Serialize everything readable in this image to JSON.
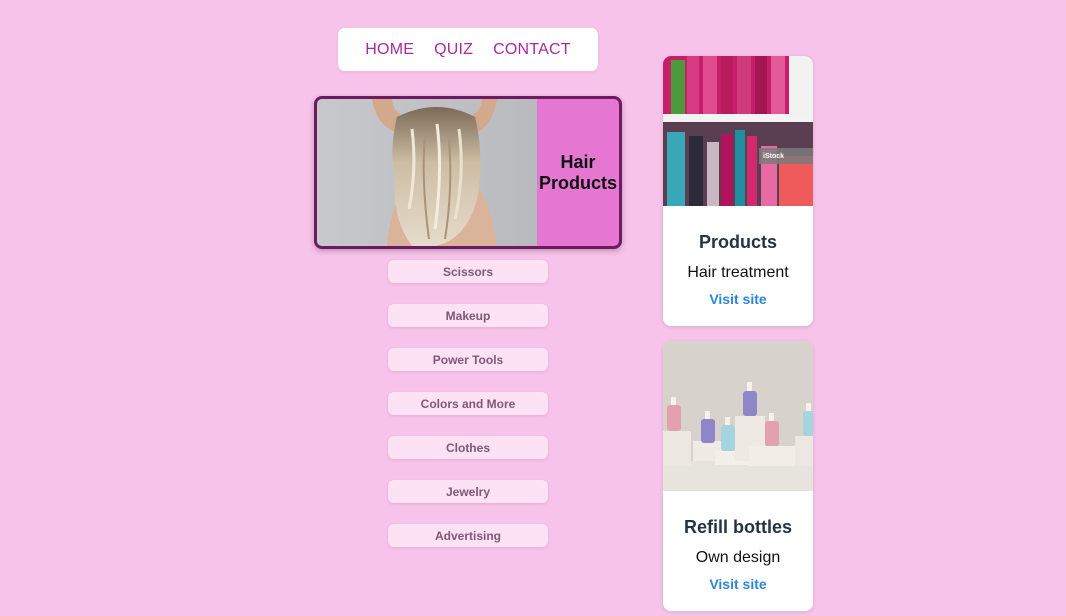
{
  "nav": {
    "items": [
      "HOME",
      "QUIZ",
      "CONTACT"
    ]
  },
  "hero": {
    "label_line1": "Hair",
    "label_line2": "Products"
  },
  "categories": [
    "Scissors",
    "Makeup",
    "Power Tools",
    "Colors and More",
    "Clothes",
    "Jewelry",
    "Advertising"
  ],
  "cards": [
    {
      "title": "Products",
      "text": "Hair treatment",
      "link": "Visit site",
      "image_watermark": "iStock"
    },
    {
      "title": "Refill bottles",
      "text": "Own design",
      "link": "Visit site"
    }
  ],
  "colors": {
    "background": "#f7c3ea",
    "nav_link": "#a62aa0",
    "hero_border": "#6d1a63",
    "hero_label_bg": "#e577d2",
    "card_link": "#2b86d6"
  }
}
